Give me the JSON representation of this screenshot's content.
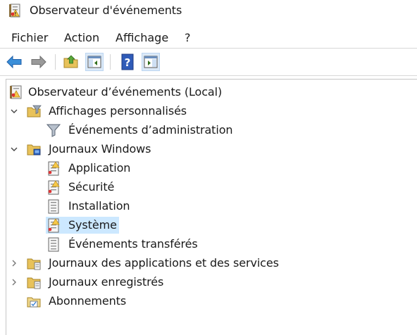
{
  "window": {
    "title": "Observateur d'événements"
  },
  "menu": [
    "Fichier",
    "Action",
    "Affichage",
    "?"
  ],
  "toolbar": {
    "buttons": [
      "back-arrow-icon",
      "forward-arrow-icon",
      "up-folder-icon",
      "show-hide-console-tree-icon",
      "help-icon",
      "show-hide-action-pane-icon"
    ]
  },
  "tree": {
    "root": "Observateur d’événements (Local)",
    "custom_views": "Affichages personnalisés",
    "admin_events": "Événements d’administration",
    "windows_logs": "Journaux Windows",
    "application": "Application",
    "security": "Sécurité",
    "setup": "Installation",
    "system": "Système",
    "forwarded": "Événements transférés",
    "app_service_logs": "Journaux des applications et des services",
    "saved_logs": "Journaux enregistrés",
    "subscriptions": "Abonnements"
  },
  "colors": {
    "selection": "#cce8ff",
    "accent_blue": "#3a78c9",
    "folder": "#e8c25a"
  }
}
